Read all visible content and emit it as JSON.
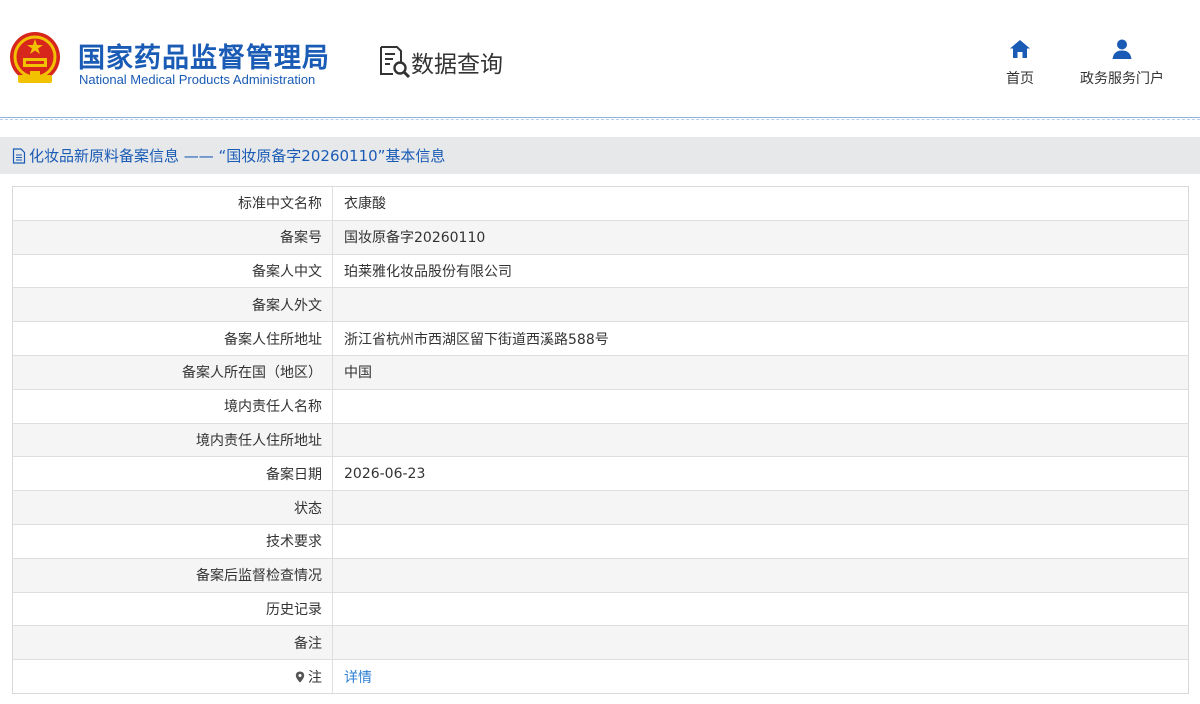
{
  "header": {
    "org_name_cn": "国家药品监督管理局",
    "org_name_en": "National Medical Products Administration",
    "section_title": "数据查询",
    "nav": {
      "home_label": "首页",
      "portal_label": "政务服务门户"
    }
  },
  "colors": {
    "brand_blue": "#1a5bb5",
    "link_blue": "#2d7fd4",
    "title_bar_bg": "#e7e8ea",
    "emblem_red": "#d7271d",
    "emblem_gold": "#f2c200"
  },
  "page": {
    "title": "化妆品新原料备案信息 —— “国妆原备字20260110”基本信息"
  },
  "details": [
    {
      "label": "标准中文名称",
      "value": "衣康酸"
    },
    {
      "label": "备案号",
      "value": "国妆原备字20260110"
    },
    {
      "label": "备案人中文",
      "value": "珀莱雅化妆品股份有限公司"
    },
    {
      "label": "备案人外文",
      "value": ""
    },
    {
      "label": "备案人住所地址",
      "value": "浙江省杭州市西湖区留下街道西溪路588号"
    },
    {
      "label": "备案人所在国（地区）",
      "value": "中国"
    },
    {
      "label": "境内责任人名称",
      "value": ""
    },
    {
      "label": "境内责任人住所地址",
      "value": ""
    },
    {
      "label": "备案日期",
      "value": "2026-06-23"
    },
    {
      "label": "状态",
      "value": ""
    },
    {
      "label": "技术要求",
      "value": ""
    },
    {
      "label": "备案后监督检查情况",
      "value": ""
    },
    {
      "label": "历史记录",
      "value": ""
    },
    {
      "label": "备注",
      "value": ""
    }
  ],
  "note_row": {
    "label": "注",
    "link_text": "详情",
    "icon": "map-pin-icon"
  },
  "icons": {
    "emblem": "national-emblem-icon",
    "query": "document-search-icon",
    "home": "home-icon",
    "portal": "user-icon",
    "title": "document-icon"
  }
}
